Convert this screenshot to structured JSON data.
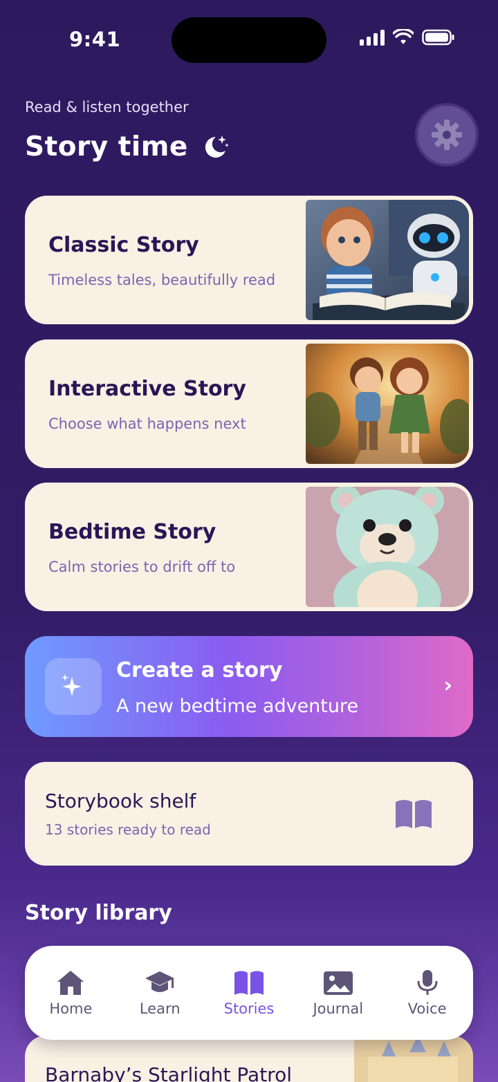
{
  "status_bar": {
    "time": "9:41"
  },
  "header": {
    "subtitle": "Read & listen together",
    "title": "Story time"
  },
  "story_cards": [
    {
      "title": "Classic Story",
      "description": "Timeless tales, beautifully read"
    },
    {
      "title": "Interactive Story",
      "description": "Choose what happens next"
    },
    {
      "title": "Bedtime Story",
      "description": "Calm stories to drift off to"
    }
  ],
  "create_story": {
    "title": "Create a story",
    "subtitle": "A new bedtime adventure",
    "chevron": "›"
  },
  "shelf": {
    "title": "Storybook shelf",
    "subtitle": "13 stories ready to read"
  },
  "library": {
    "heading": "Story library",
    "items": [
      {
        "title": "Barnaby’s Starlight Patrol"
      }
    ]
  },
  "bottom_nav": {
    "items": [
      {
        "label": "Home",
        "icon": "home-icon"
      },
      {
        "label": "Learn",
        "icon": "graduation-cap-icon"
      },
      {
        "label": "Stories",
        "icon": "book-open-icon",
        "active": true
      },
      {
        "label": "Journal",
        "icon": "image-icon"
      },
      {
        "label": "Voice",
        "icon": "microphone-icon"
      }
    ]
  },
  "colors": {
    "background": "#2d1a5e",
    "card": "#faf1e4",
    "accent": "#7a52e6",
    "title_text": "#2a1656",
    "muted_text": "#7a64b0"
  }
}
